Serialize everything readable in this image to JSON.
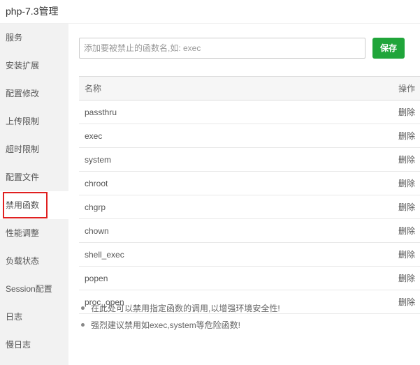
{
  "window": {
    "title": "php-7.3管理"
  },
  "sidebar": {
    "items": [
      {
        "label": "服务"
      },
      {
        "label": "安装扩展"
      },
      {
        "label": "配置修改"
      },
      {
        "label": "上传限制"
      },
      {
        "label": "超时限制"
      },
      {
        "label": "配置文件"
      },
      {
        "label": "禁用函数",
        "active": true
      },
      {
        "label": "性能调整"
      },
      {
        "label": "负载状态"
      },
      {
        "label": "Session配置"
      },
      {
        "label": "日志"
      },
      {
        "label": "慢日志"
      }
    ]
  },
  "form": {
    "placeholder": "添加要被禁止的函数名,如: exec",
    "value": "",
    "save_label": "保存"
  },
  "table": {
    "headers": {
      "name": "名称",
      "action": "操作"
    },
    "rows": [
      {
        "name": "passthru",
        "action": "删除"
      },
      {
        "name": "exec",
        "action": "删除"
      },
      {
        "name": "system",
        "action": "删除"
      },
      {
        "name": "chroot",
        "action": "删除"
      },
      {
        "name": "chgrp",
        "action": "删除"
      },
      {
        "name": "chown",
        "action": "删除"
      },
      {
        "name": "shell_exec",
        "action": "删除"
      },
      {
        "name": "popen",
        "action": "删除"
      },
      {
        "name": "proc_open",
        "action": "删除"
      }
    ]
  },
  "tips": [
    "在此处可以禁用指定函数的调用,以增强环境安全性!",
    "强烈建议禁用如exec,system等危险函数!"
  ],
  "colors": {
    "accent": "#20a53a",
    "highlight_border": "#e02020",
    "sidebar_bg": "#f2f2f2"
  }
}
